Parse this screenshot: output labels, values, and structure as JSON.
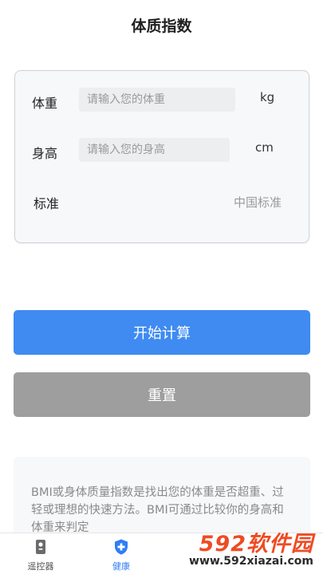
{
  "header": {
    "title": "体质指数"
  },
  "form": {
    "weight": {
      "label": "体重",
      "placeholder": "请输入您的体重",
      "value": "",
      "unit": "kg"
    },
    "height": {
      "label": "身高",
      "placeholder": "请输入您的身高",
      "value": "",
      "unit": "cm"
    },
    "standard": {
      "label": "标准",
      "value": "中国标准"
    }
  },
  "actions": {
    "start_label": "开始计算",
    "reset_label": "重置"
  },
  "description": {
    "text": "BMI或身体质量指数是找出您的体重是否超重、过轻或理想的快速方法。BMI可通过比较你的身高和体重来判定"
  },
  "tabbar": {
    "tabs": [
      {
        "label": "遥控器",
        "icon": "remote-icon",
        "active": false
      },
      {
        "label": "健康",
        "icon": "health-shield-icon",
        "active": true
      }
    ],
    "active_color": "#2f7df6",
    "inactive_color": "#555555"
  },
  "watermark": {
    "main": "592软件园",
    "sub": "www.592xiazai.com"
  },
  "colors": {
    "primary": "#3f8bf2",
    "reset": "#9e9e9e"
  }
}
